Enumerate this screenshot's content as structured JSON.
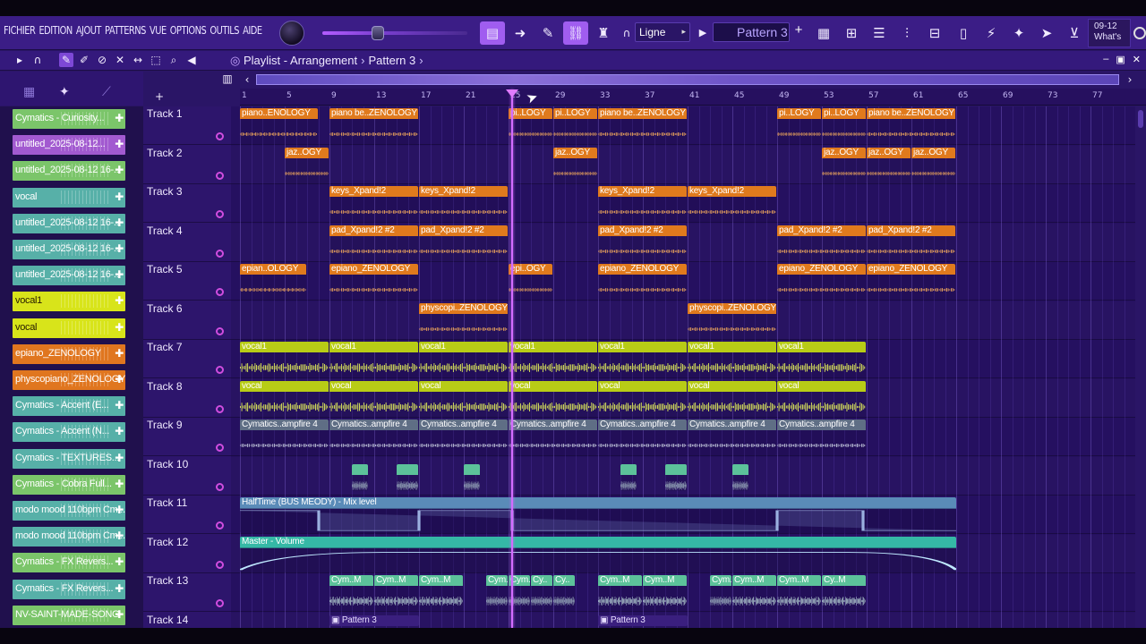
{
  "menu": [
    "FICHIER",
    "EDITION",
    "AJOUT",
    "PATTERNS",
    "VUE",
    "OPTIONS",
    "OUTILS",
    "AIDE"
  ],
  "toolbar": {
    "snap_value": "Ligne",
    "pattern_value": "Pattern 3",
    "news_date": "09-12",
    "news_label": "What's",
    "icons": [
      "piano-roll-icon",
      "arrow-right-icon",
      "brush-icon",
      "link-icon",
      "stamp-icon",
      "magnet-icon",
      "playlist-icon",
      "channel-rack-icon",
      "browser-icon",
      "mixer-icon",
      "plugin-icon",
      "file-icon",
      "plug-icon",
      "wand-icon",
      "send-icon",
      "cart-icon"
    ]
  },
  "playlist": {
    "title": "Playlist - Arrangement",
    "pattern": "Pattern 3",
    "arrow": "›"
  },
  "ruler": {
    "ticks": [
      "1",
      "5",
      "9",
      "13",
      "17",
      "21",
      "25",
      "29",
      "33",
      "37",
      "41",
      "45",
      "49",
      "53",
      "57",
      "61",
      "65",
      "69",
      "73",
      "77"
    ],
    "playhead_bar": 25
  },
  "channels": [
    {
      "label": "Cymatics - Curiosity...",
      "color": "#7bc56a"
    },
    {
      "label": "untitled_2025-08-12...",
      "color": "#a25ad0"
    },
    {
      "label": "untitled_2025-08-12 16-...",
      "color": "#7bc56a"
    },
    {
      "label": "vocal",
      "color": "#57b0a8"
    },
    {
      "label": "untitled_2025-08-12 16-...",
      "color": "#57b0a8"
    },
    {
      "label": "untitled_2025-08-12 16-...",
      "color": "#57b0a8"
    },
    {
      "label": "untitled_2025-08-12 16-...",
      "color": "#57b0a8"
    },
    {
      "label": "vocal1",
      "color": "#d8e41a"
    },
    {
      "label": "vocal",
      "color": "#d8e41a"
    },
    {
      "label": "epiano_ZENOLOGY",
      "color": "#e0761f"
    },
    {
      "label": "physcopiano_ZENOLOGY",
      "color": "#e0761f"
    },
    {
      "label": "Cymatics - Accent (E...",
      "color": "#57b0a8"
    },
    {
      "label": "Cymatics - Accent (N...",
      "color": "#57b0a8"
    },
    {
      "label": "Cymatics - TEXTURES...",
      "color": "#57b0a8"
    },
    {
      "label": "Cymatics - Cobra Full...",
      "color": "#7bc56a"
    },
    {
      "label": "modo mood 110bpm Cm...",
      "color": "#57b0a8"
    },
    {
      "label": "modo mood 110bpm Cm...",
      "color": "#57b0a8"
    },
    {
      "label": "Cymatics - FX Revers...",
      "color": "#7bc56a"
    },
    {
      "label": "Cymatics - FX Revers...",
      "color": "#57b0a8"
    },
    {
      "label": "NV-SAINT-MADE-SONG",
      "color": "#7bc56a"
    }
  ],
  "tracks": [
    {
      "name": "Track 1"
    },
    {
      "name": "Track 2"
    },
    {
      "name": "Track 3"
    },
    {
      "name": "Track 4"
    },
    {
      "name": "Track 5"
    },
    {
      "name": "Track 6"
    },
    {
      "name": "Track 7"
    },
    {
      "name": "Track 8"
    },
    {
      "name": "Track 9"
    },
    {
      "name": "Track 10"
    },
    {
      "name": "Track 11"
    },
    {
      "name": "Track 12"
    },
    {
      "name": "Track 13"
    },
    {
      "name": "Track 14"
    }
  ],
  "clips": [
    {
      "track": 0,
      "start": 1,
      "len": 7,
      "label": "piano..ENOLOGY",
      "color": "orange"
    },
    {
      "track": 0,
      "start": 9,
      "len": 8,
      "label": "piano be..ZENOLOGY",
      "color": "orange"
    },
    {
      "track": 0,
      "start": 25,
      "len": 4,
      "label": "pi..LOGY",
      "color": "orange"
    },
    {
      "track": 0,
      "start": 29,
      "len": 4,
      "label": "pi..LOGY",
      "color": "orange"
    },
    {
      "track": 0,
      "start": 33,
      "len": 8,
      "label": "piano be..ZENOLOGY",
      "color": "orange"
    },
    {
      "track": 0,
      "start": 49,
      "len": 4,
      "label": "pi..LOGY",
      "color": "orange"
    },
    {
      "track": 0,
      "start": 53,
      "len": 4,
      "label": "pi..LOGY",
      "color": "orange"
    },
    {
      "track": 0,
      "start": 57,
      "len": 8,
      "label": "piano be..ZENOLOGY",
      "color": "orange"
    },
    {
      "track": 1,
      "start": 5,
      "len": 4,
      "label": "jaz..OGY",
      "color": "orange"
    },
    {
      "track": 1,
      "start": 29,
      "len": 4,
      "label": "jaz..OGY",
      "color": "orange"
    },
    {
      "track": 1,
      "start": 53,
      "len": 4,
      "label": "jaz..OGY",
      "color": "orange"
    },
    {
      "track": 1,
      "start": 57,
      "len": 4,
      "label": "jaz..OGY",
      "color": "orange"
    },
    {
      "track": 1,
      "start": 61,
      "len": 4,
      "label": "jaz..OGY",
      "color": "orange"
    },
    {
      "track": 2,
      "start": 9,
      "len": 8,
      "label": "keys_Xpand!2",
      "color": "orange"
    },
    {
      "track": 2,
      "start": 17,
      "len": 8,
      "label": "keys_Xpand!2",
      "color": "orange"
    },
    {
      "track": 2,
      "start": 33,
      "len": 8,
      "label": "keys_Xpand!2",
      "color": "orange"
    },
    {
      "track": 2,
      "start": 41,
      "len": 8,
      "label": "keys_Xpand!2",
      "color": "orange"
    },
    {
      "track": 3,
      "start": 9,
      "len": 8,
      "label": "pad_Xpand!2 #2",
      "color": "orange"
    },
    {
      "track": 3,
      "start": 17,
      "len": 8,
      "label": "pad_Xpand!2 #2",
      "color": "orange"
    },
    {
      "track": 3,
      "start": 33,
      "len": 8,
      "label": "pad_Xpand!2 #2",
      "color": "orange"
    },
    {
      "track": 3,
      "start": 49,
      "len": 8,
      "label": "pad_Xpand!2 #2",
      "color": "orange"
    },
    {
      "track": 3,
      "start": 57,
      "len": 8,
      "label": "pad_Xpand!2 #2",
      "color": "orange"
    },
    {
      "track": 4,
      "start": 1,
      "len": 6,
      "label": "epian..OLOGY",
      "color": "orange"
    },
    {
      "track": 4,
      "start": 9,
      "len": 8,
      "label": "epiano_ZENOLOGY",
      "color": "orange"
    },
    {
      "track": 4,
      "start": 25,
      "len": 4,
      "label": "epi..OGY",
      "color": "orange"
    },
    {
      "track": 4,
      "start": 33,
      "len": 8,
      "label": "epiano_ZENOLOGY",
      "color": "orange"
    },
    {
      "track": 4,
      "start": 49,
      "len": 8,
      "label": "epiano_ZENOLOGY",
      "color": "orange"
    },
    {
      "track": 4,
      "start": 57,
      "len": 8,
      "label": "epiano_ZENOLOGY",
      "color": "orange"
    },
    {
      "track": 5,
      "start": 17,
      "len": 8,
      "label": "physcopi..ZENOLOGY",
      "color": "orange"
    },
    {
      "track": 5,
      "start": 41,
      "len": 8,
      "label": "physcopi..ZENOLOGY",
      "color": "orange"
    },
    {
      "track": 6,
      "start": 1,
      "len": 8,
      "label": "vocal1",
      "color": "lime"
    },
    {
      "track": 6,
      "start": 9,
      "len": 8,
      "label": "vocal1",
      "color": "lime"
    },
    {
      "track": 6,
      "start": 17,
      "len": 8,
      "label": "vocal1",
      "color": "lime"
    },
    {
      "track": 6,
      "start": 25,
      "len": 8,
      "label": "vocal1",
      "color": "lime"
    },
    {
      "track": 6,
      "start": 33,
      "len": 8,
      "label": "vocal1",
      "color": "lime"
    },
    {
      "track": 6,
      "start": 41,
      "len": 8,
      "label": "vocal1",
      "color": "lime"
    },
    {
      "track": 6,
      "start": 49,
      "len": 8,
      "label": "vocal1",
      "color": "lime"
    },
    {
      "track": 7,
      "start": 1,
      "len": 8,
      "label": "vocal",
      "color": "lime"
    },
    {
      "track": 7,
      "start": 9,
      "len": 8,
      "label": "vocal",
      "color": "lime"
    },
    {
      "track": 7,
      "start": 17,
      "len": 8,
      "label": "vocal",
      "color": "lime"
    },
    {
      "track": 7,
      "start": 25,
      "len": 8,
      "label": "vocal",
      "color": "lime"
    },
    {
      "track": 7,
      "start": 33,
      "len": 8,
      "label": "vocal",
      "color": "lime"
    },
    {
      "track": 7,
      "start": 41,
      "len": 8,
      "label": "vocal",
      "color": "lime"
    },
    {
      "track": 7,
      "start": 49,
      "len": 8,
      "label": "vocal",
      "color": "lime"
    },
    {
      "track": 8,
      "start": 1,
      "len": 8,
      "label": "Cymatics..ampfire 4",
      "color": "slate"
    },
    {
      "track": 8,
      "start": 9,
      "len": 8,
      "label": "Cymatics..ampfire 4",
      "color": "slate"
    },
    {
      "track": 8,
      "start": 17,
      "len": 8,
      "label": "Cymatics..ampfire 4",
      "color": "slate"
    },
    {
      "track": 8,
      "start": 25,
      "len": 8,
      "label": "Cymatics..ampfire 4",
      "color": "slate"
    },
    {
      "track": 8,
      "start": 33,
      "len": 8,
      "label": "Cymatics..ampfire 4",
      "color": "slate"
    },
    {
      "track": 8,
      "start": 41,
      "len": 8,
      "label": "Cymatics..ampfire 4",
      "color": "slate"
    },
    {
      "track": 8,
      "start": 49,
      "len": 8,
      "label": "Cymatics..ampfire 4",
      "color": "slate"
    },
    {
      "track": 9,
      "start": 11,
      "len": 1.5,
      "label": "",
      "color": "mint"
    },
    {
      "track": 9,
      "start": 15,
      "len": 2,
      "label": "",
      "color": "mint"
    },
    {
      "track": 9,
      "start": 21,
      "len": 1.5,
      "label": "",
      "color": "mint"
    },
    {
      "track": 9,
      "start": 35,
      "len": 1.5,
      "label": "",
      "color": "mint"
    },
    {
      "track": 9,
      "start": 39,
      "len": 2,
      "label": "",
      "color": "mint"
    },
    {
      "track": 9,
      "start": 45,
      "len": 1.5,
      "label": "",
      "color": "mint"
    },
    {
      "track": 12,
      "start": 9,
      "len": 4,
      "label": "Cym..M",
      "color": "mint"
    },
    {
      "track": 12,
      "start": 13,
      "len": 4,
      "label": "Cym..M",
      "color": "mint"
    },
    {
      "track": 12,
      "start": 17,
      "len": 4,
      "label": "Cym..M",
      "color": "mint"
    },
    {
      "track": 12,
      "start": 23,
      "len": 2,
      "label": "Cym..PM",
      "color": "mint"
    },
    {
      "track": 12,
      "start": 25,
      "len": 2,
      "label": "Cym..PM",
      "color": "mint"
    },
    {
      "track": 12,
      "start": 27,
      "len": 2,
      "label": "Cy..",
      "color": "mint"
    },
    {
      "track": 12,
      "start": 29,
      "len": 2,
      "label": "Cy..",
      "color": "mint"
    },
    {
      "track": 12,
      "start": 33,
      "len": 4,
      "label": "Cym..M",
      "color": "mint"
    },
    {
      "track": 12,
      "start": 37,
      "len": 4,
      "label": "Cym..M",
      "color": "mint"
    },
    {
      "track": 12,
      "start": 43,
      "len": 2,
      "label": "Cym..",
      "color": "mint"
    },
    {
      "track": 12,
      "start": 45,
      "len": 4,
      "label": "Cym..M",
      "color": "mint"
    },
    {
      "track": 12,
      "start": 49,
      "len": 4,
      "label": "Cym..M",
      "color": "mint"
    },
    {
      "track": 12,
      "start": 53,
      "len": 4,
      "label": "Cy..M",
      "color": "mint"
    }
  ],
  "automation": [
    {
      "track": 10,
      "start": 1,
      "len": 64,
      "label": "HalfTime (BUS MEODY) - Mix level",
      "color": "#5a8bb8"
    },
    {
      "track": 11,
      "start": 1,
      "len": 64,
      "label": "Master - Volume",
      "color": "#35b8a6"
    }
  ],
  "pattern_clips": [
    {
      "track": 13,
      "start": 9,
      "len": 8,
      "label": "Pattern 3"
    },
    {
      "track": 13,
      "start": 33,
      "len": 8,
      "label": "Pattern 3"
    }
  ],
  "colors": {
    "orange": "#e07a1d",
    "lime": "#b8cc16",
    "slate": "#5f6e85",
    "mint": "#5cc29a",
    "accent": "#a05df0",
    "playhead": "#d36cff"
  }
}
